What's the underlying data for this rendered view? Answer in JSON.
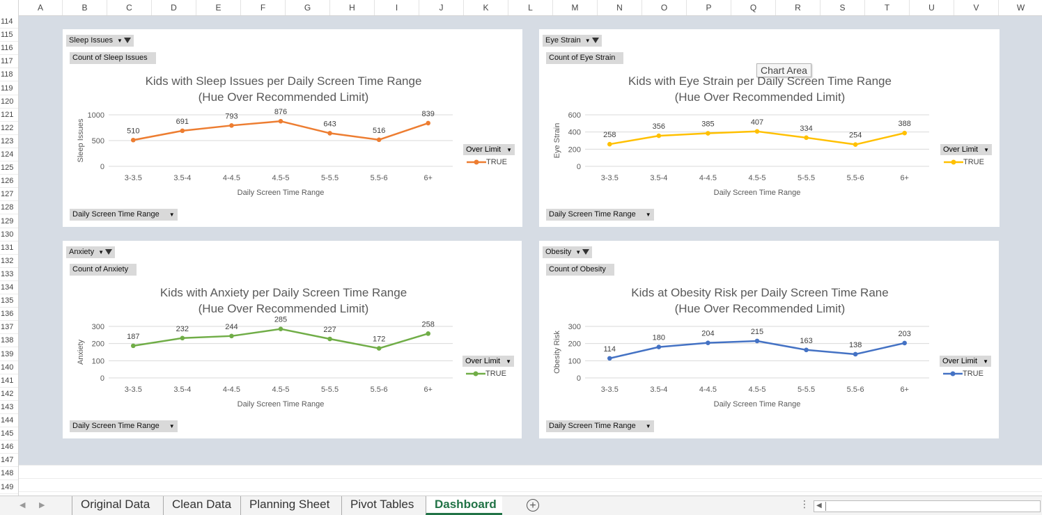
{
  "sheet": {
    "columns": [
      "A",
      "B",
      "C",
      "D",
      "E",
      "F",
      "G",
      "H",
      "I",
      "J",
      "K",
      "L",
      "M",
      "N",
      "O",
      "P",
      "Q",
      "R",
      "S",
      "T",
      "U",
      "V",
      "W"
    ],
    "rows": [
      "114",
      "115",
      "116",
      "117",
      "118",
      "119",
      "120",
      "121",
      "122",
      "123",
      "124",
      "125",
      "126",
      "127",
      "128",
      "129",
      "130",
      "131",
      "132",
      "133",
      "134",
      "135",
      "136",
      "137",
      "138",
      "139",
      "140",
      "141",
      "142",
      "143",
      "144",
      "145",
      "146",
      "147",
      "148",
      "149"
    ]
  },
  "tooltip": "Chart Area",
  "tabs": {
    "items": [
      "Original Data",
      "Clean Data",
      "Planning Sheet",
      "Pivot Tables",
      "Dashboard"
    ],
    "active": "Dashboard",
    "add_symbol": "+"
  },
  "charts": [
    {
      "filter_label": "Sleep Issues",
      "value_label": "Count of Sleep Issues",
      "axis_button": "Daily Screen Time Range",
      "legend_filter": "Over Limit",
      "legend_item": "TRUE",
      "color": "#ed7d31"
    },
    {
      "filter_label": "Eye Strain",
      "value_label": "Count of Eye Strain",
      "axis_button": "Daily Screen Time Range",
      "legend_filter": "Over Limit",
      "legend_item": "TRUE",
      "color": "#ffc000"
    },
    {
      "filter_label": "Anxiety",
      "value_label": "Count of Anxiety",
      "axis_button": "Daily Screen Time Range",
      "legend_filter": "Over Limit",
      "legend_item": "TRUE",
      "color": "#70ad47"
    },
    {
      "filter_label": "Obesity",
      "value_label": "Count of Obesity",
      "axis_button": "Daily Screen Time Range",
      "legend_filter": "Over Limit",
      "legend_item": "TRUE",
      "color": "#4472c4"
    }
  ],
  "chart_data": [
    {
      "type": "line",
      "title": "Kids with Sleep Issues per Daily Screen Time Range",
      "subtitle": "(Hue Over Recommended Limit)",
      "xlabel": "Daily Screen Time Range",
      "ylabel": "Sleep Issues",
      "categories": [
        "3-3.5",
        "3.5-4",
        "4-4.5",
        "4.5-5",
        "5-5.5",
        "5.5-6",
        "6+"
      ],
      "series": [
        {
          "name": "TRUE",
          "values": [
            510,
            691,
            793,
            876,
            643,
            516,
            839
          ]
        }
      ],
      "ylim": [
        0,
        1000
      ],
      "yticks": [
        0,
        500,
        1000
      ],
      "grid": true,
      "legend": "right"
    },
    {
      "type": "line",
      "title": "Kids with Eye Strain per Daily Screen Time Range",
      "subtitle": "(Hue Over Recommended Limit)",
      "xlabel": "Daily Screen Time Range",
      "ylabel": "Eye Strain",
      "categories": [
        "3-3.5",
        "3.5-4",
        "4-4.5",
        "4.5-5",
        "5-5.5",
        "5.5-6",
        "6+"
      ],
      "series": [
        {
          "name": "TRUE",
          "values": [
            258,
            356,
            385,
            407,
            334,
            254,
            388
          ]
        }
      ],
      "ylim": [
        0,
        600
      ],
      "yticks": [
        0,
        200,
        400,
        600
      ],
      "grid": true,
      "legend": "right"
    },
    {
      "type": "line",
      "title": "Kids with Anxiety per Daily Screen Time Range",
      "subtitle": "(Hue Over Recommended Limit)",
      "xlabel": "Daily Screen Time Range",
      "ylabel": "Anxiety",
      "categories": [
        "3-3.5",
        "3.5-4",
        "4-4.5",
        "4.5-5",
        "5-5.5",
        "5.5-6",
        "6+"
      ],
      "series": [
        {
          "name": "TRUE",
          "values": [
            187,
            232,
            244,
            285,
            227,
            172,
            258
          ]
        }
      ],
      "ylim": [
        0,
        300
      ],
      "yticks": [
        0,
        100,
        200,
        300
      ],
      "grid": true,
      "legend": "right"
    },
    {
      "type": "line",
      "title": "Kids at Obesity Risk per Daily Screen Time Rane",
      "subtitle": "(Hue Over Recommended Limit)",
      "xlabel": "Daily Screen Time Range",
      "ylabel": "Obesity Risk",
      "categories": [
        "3-3.5",
        "3.5-4",
        "4-4.5",
        "4.5-5",
        "5-5.5",
        "5.5-6",
        "6+"
      ],
      "series": [
        {
          "name": "TRUE",
          "values": [
            114,
            180,
            204,
            215,
            163,
            138,
            203
          ]
        }
      ],
      "ylim": [
        0,
        300
      ],
      "yticks": [
        0,
        100,
        200,
        300
      ],
      "grid": true,
      "legend": "right"
    }
  ]
}
